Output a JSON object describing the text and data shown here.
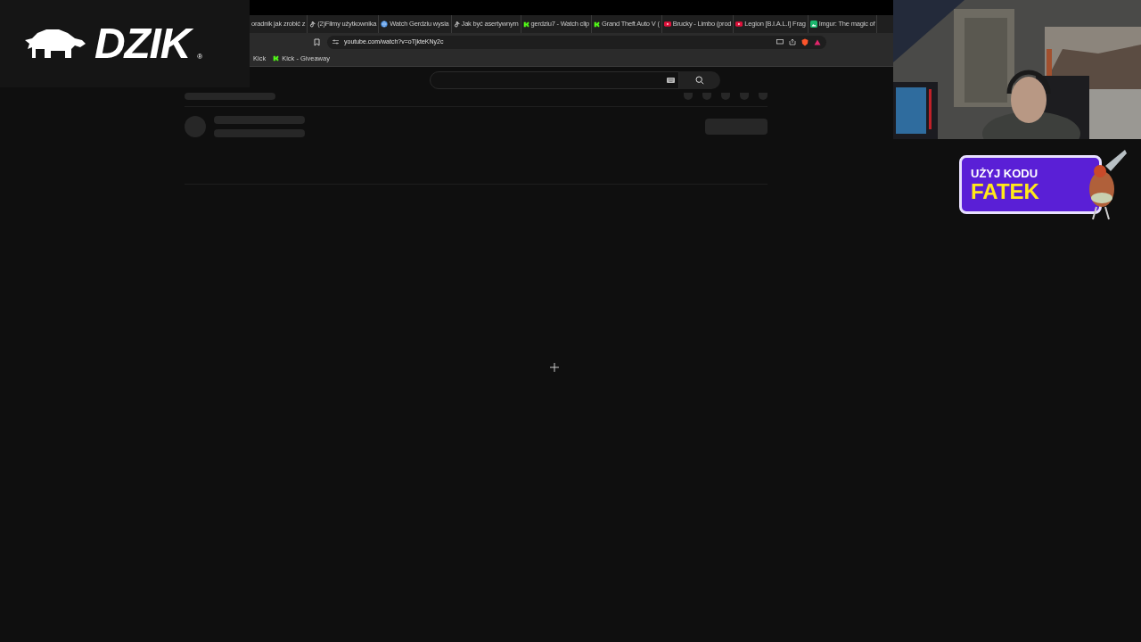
{
  "logo": {
    "text": "DZIK",
    "mark": "®"
  },
  "browser": {
    "tabs": [
      {
        "title": "oradnik jak zrobić z",
        "kind": "plain"
      },
      {
        "title": "(2)Filmy użytkownika",
        "kind": "note"
      },
      {
        "title": "Watch Gerdziu wysia",
        "kind": "globe"
      },
      {
        "title": "Jak być asertywnym",
        "kind": "note"
      },
      {
        "title": "gerdziu7 - Watch clip",
        "kind": "k"
      },
      {
        "title": "Grand Theft Auto V (",
        "kind": "k"
      },
      {
        "title": "Brucky - Limbo (prod",
        "kind": "play"
      },
      {
        "title": "Legion [B.I.A.L.I] Frag",
        "kind": "play"
      },
      {
        "title": "Imgur: The magic of",
        "kind": "imgur"
      }
    ],
    "address": "youtube.com/watch?v=oTjkteKNy2c",
    "bookmarks": [
      {
        "label": "Kick",
        "kind": "plain"
      },
      {
        "label": "Kick - Giveaway",
        "kind": "k"
      }
    ]
  },
  "promo": {
    "line1": "UŻYJ KODU",
    "line2": "FATEK"
  }
}
